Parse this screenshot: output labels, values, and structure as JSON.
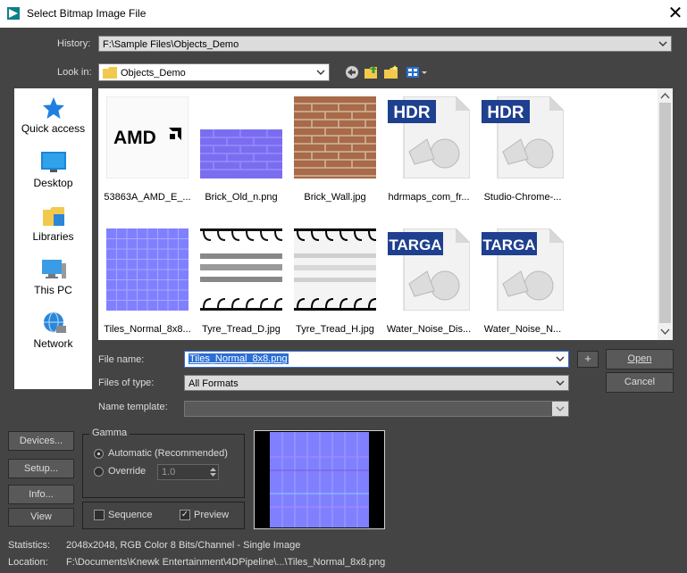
{
  "window": {
    "title": "Select Bitmap Image File",
    "close_icon": "close-icon",
    "app_icon": "3dsmax-app-icon"
  },
  "history": {
    "label": "History:",
    "value": "F:\\Sample Files\\Objects_Demo"
  },
  "look_in": {
    "label": "Look in:",
    "value": "Objects_Demo"
  },
  "toolbar": {
    "icons": [
      "back-icon",
      "up-folder-icon",
      "new-folder-icon",
      "view-menu-icon"
    ]
  },
  "places": [
    {
      "label": "Quick access",
      "icon": "star-icon"
    },
    {
      "label": "Desktop",
      "icon": "desktop-icon"
    },
    {
      "label": "Libraries",
      "icon": "libraries-icon"
    },
    {
      "label": "This PC",
      "icon": "computer-icon"
    },
    {
      "label": "Network",
      "icon": "network-icon"
    }
  ],
  "files": [
    {
      "name": "53863A_AMD_E_...",
      "thumb": "AMD logo"
    },
    {
      "name": "Brick_Old_n.png",
      "thumb": "blue normal-map bricks"
    },
    {
      "name": "Brick_Wall.jpg",
      "thumb": "red brick wall"
    },
    {
      "name": "hdrmaps_com_fr...",
      "thumb": "HDR"
    },
    {
      "name": "Studio-Chrome-...",
      "thumb": "HDR"
    },
    {
      "name": "Tiles_Normal_8x8...",
      "thumb": "blue normal-map tiles"
    },
    {
      "name": "Tyre_Tread_D.jpg",
      "thumb": "tyre tread diffuse"
    },
    {
      "name": "Tyre_Tread_H.jpg",
      "thumb": "tyre tread height"
    },
    {
      "name": "Water_Noise_Dis...",
      "thumb": "TARGA"
    },
    {
      "name": "Water_Noise_N...",
      "thumb": "TARGA"
    }
  ],
  "badges": {
    "hdr": "HDR",
    "targa": "TARGA",
    "amd": "AMD"
  },
  "file_name": {
    "label": "File name:",
    "value": "Tiles_Normal_8x8.png"
  },
  "files_of_type": {
    "label": "Files of type:",
    "value": "All Formats"
  },
  "name_template": {
    "label": "Name template:",
    "value": ""
  },
  "buttons": {
    "plus": "+",
    "open": "Open",
    "cancel": "Cancel",
    "devices": "Devices...",
    "setup": "Setup...",
    "info": "Info...",
    "view": "View"
  },
  "gamma": {
    "title": "Gamma",
    "automatic": "Automatic (Recommended)",
    "override": "Override",
    "override_value": "1.0",
    "selected": "automatic"
  },
  "options": {
    "sequence": "Sequence",
    "sequence_checked": false,
    "preview": "Preview",
    "preview_checked": true
  },
  "statistics": {
    "label": "Statistics:",
    "value": "2048x2048, RGB Color 8 Bits/Channel - Single Image"
  },
  "location": {
    "label": "Location:",
    "value": "F:\\Documents\\Knewk Entertainment\\4DPipeline\\...\\Tiles_Normal_8x8.png"
  }
}
